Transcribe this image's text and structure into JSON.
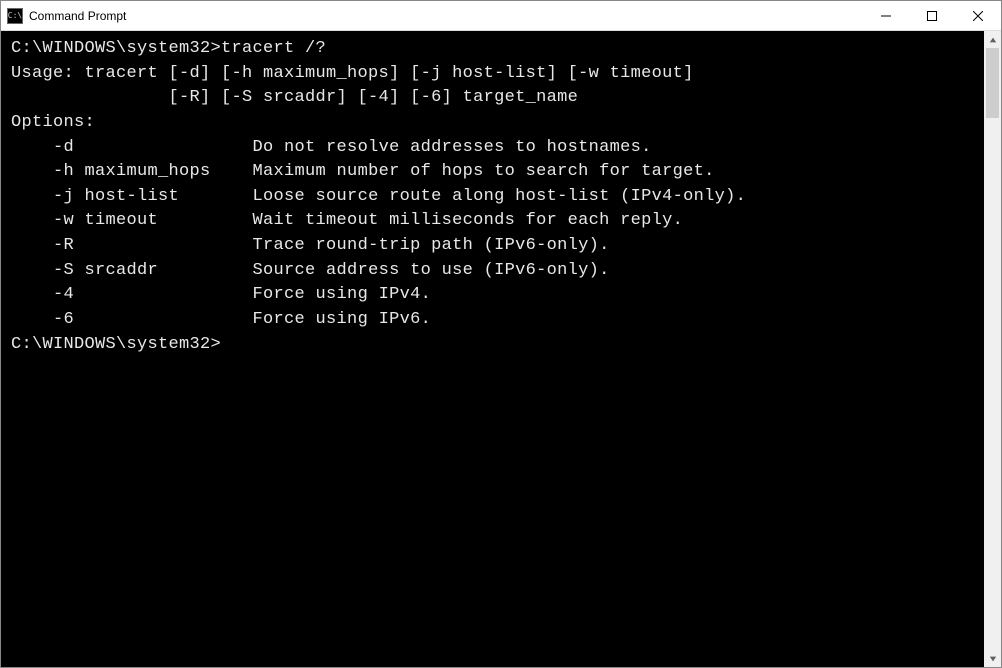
{
  "window": {
    "title": "Command Prompt",
    "icon_label": "C:\\"
  },
  "terminal": {
    "prompt1_path": "C:\\WINDOWS\\system32>",
    "prompt1_cmd": "tracert /?",
    "blank": "",
    "usage_line1": "Usage: tracert [-d] [-h maximum_hops] [-j host-list] [-w timeout]",
    "usage_line2": "               [-R] [-S srcaddr] [-4] [-6] target_name",
    "options_header": "Options:",
    "options": [
      {
        "flag": "    -d                 ",
        "desc": "Do not resolve addresses to hostnames."
      },
      {
        "flag": "    -h maximum_hops    ",
        "desc": "Maximum number of hops to search for target."
      },
      {
        "flag": "    -j host-list       ",
        "desc": "Loose source route along host-list (IPv4-only)."
      },
      {
        "flag": "    -w timeout         ",
        "desc": "Wait timeout milliseconds for each reply."
      },
      {
        "flag": "    -R                 ",
        "desc": "Trace round-trip path (IPv6-only)."
      },
      {
        "flag": "    -S srcaddr         ",
        "desc": "Source address to use (IPv6-only)."
      },
      {
        "flag": "    -4                 ",
        "desc": "Force using IPv4."
      },
      {
        "flag": "    -6                 ",
        "desc": "Force using IPv6."
      }
    ],
    "prompt2_path": "C:\\WINDOWS\\system32>",
    "prompt2_cmd": ""
  }
}
